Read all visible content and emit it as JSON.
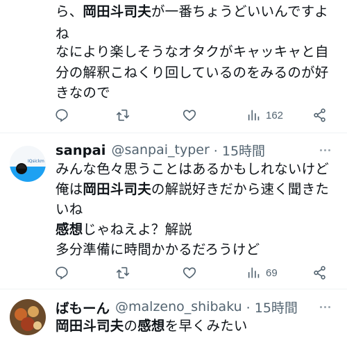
{
  "post1": {
    "lines": [
      [
        {
          "t": "ら、",
          "b": false
        },
        {
          "t": "岡田斗司夫",
          "b": true
        },
        {
          "t": "が一番ちょうどいいんですよ",
          "b": false
        }
      ],
      [
        {
          "t": "ね",
          "b": false
        }
      ],
      [
        {
          "t": "なにより楽しそうなオタクがキャッキャと自",
          "b": false
        }
      ],
      [
        {
          "t": "分の解釈こねくり回しているのをみるのが好",
          "b": false
        }
      ],
      [
        {
          "t": "きなので",
          "b": false
        }
      ]
    ],
    "views": "162"
  },
  "post2": {
    "name": "sanpai",
    "handle": "@sanpai_typer",
    "time": "· 15時間",
    "avatar_label": "IQsickm",
    "lines": [
      [
        {
          "t": "みんな色々思うことはあるかもしれないけど",
          "b": false
        }
      ],
      [
        {
          "t": "俺は",
          "b": false
        },
        {
          "t": "岡田斗司夫",
          "b": true
        },
        {
          "t": "の解説好きだから速く聞きた",
          "b": false
        }
      ],
      [
        {
          "t": "いね",
          "b": false
        }
      ],
      [
        {
          "t": "感想",
          "b": true
        },
        {
          "t": "じゃねえよ？解説",
          "b": false
        }
      ],
      [
        {
          "t": "多分準備に時間かかるだろうけど",
          "b": false
        }
      ]
    ],
    "views": "69"
  },
  "post3": {
    "name": "ばもーん",
    "handle": "@malzeno_shibaku",
    "time": "· 15時間",
    "lines": [
      [
        {
          "t": "岡田斗司夫",
          "b": true
        },
        {
          "t": "の",
          "b": false
        },
        {
          "t": "感想",
          "b": true
        },
        {
          "t": "を早くみたい",
          "b": false
        }
      ]
    ]
  },
  "icons": [
    "reply-icon",
    "retweet-icon",
    "like-icon",
    "views-icon",
    "share-icon",
    "more-icon"
  ],
  "colors": {
    "text": "#0f1419",
    "secondary": "#536471",
    "divider": "#eff3f4"
  }
}
